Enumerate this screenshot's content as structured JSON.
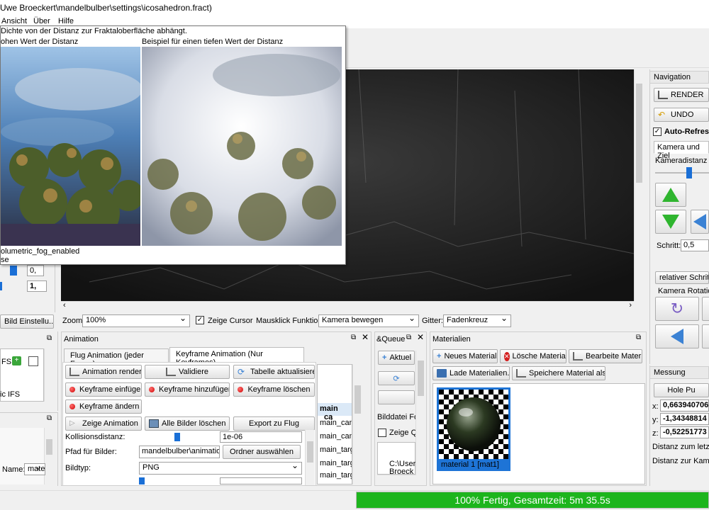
{
  "window": {
    "title": "Uwe Broeckert\\mandelbulber\\settings\\icosahedron.fract)"
  },
  "menu": [
    "Ansicht",
    "Über",
    "Hilfe"
  ],
  "tooltip": {
    "line1": "Dichte von der Distanz zur Fraktaloberfläche abhängt.",
    "caption_left": "ohen Wert der Distanz",
    "caption_right": "Beispiel für einen tiefen Wert der Distanz",
    "param": "olumetric_fog_enabled",
    "param2": "se"
  },
  "left_top": {
    "value1": "0,",
    "value2": "1,",
    "bild_btn": "Bild Einstellu..."
  },
  "viewer_bar": {
    "zoom_label": "Zoom:",
    "zoom_value": "100%",
    "cursor_label": "Zeige Cursor",
    "maus_label": "Mausklick Funktion:",
    "maus_value": "Kamera bewegen",
    "gitter_label": "Gitter:",
    "gitter_value": "Fadenkreuz"
  },
  "navigation": {
    "title": "Navigation",
    "render": "RENDER",
    "undo": "UNDO",
    "auto_refresh": "Auto-Refres",
    "kamera_tab": "Kamera und Ziel",
    "kameradistanz": "Kameradistanz zu",
    "schritt_label": "Schritt:",
    "schritt_value": "0,5",
    "relativer": "relativer Schrittm",
    "kamera_rotation": "Kamera Rotation"
  },
  "left_mid": {
    "fs_label": "FS",
    "ic_label": "ic IFS"
  },
  "left_bottom": {
    "name_label": "Name:",
    "name_value": "mate"
  },
  "animation": {
    "title": "Animation",
    "tab_flug": "Flug Animation (jeder Frame)",
    "tab_keyframe": "Keyframe Animation (Nur Keyframes)",
    "btn_render": "Animation rendern",
    "btn_validiere": "Validiere",
    "btn_tabelle": "Tabelle aktualisieren",
    "btn_einfuegen": "Keyframe einfügen",
    "btn_hinzufuegen": "Keyframe hinzufügen",
    "btn_loeschen": "Keyframe löschen",
    "btn_aendern": "Keyframe ändern",
    "btn_zeige": "Zeige Animation",
    "btn_alle": "Alle Bilder löschen",
    "btn_export": "Export zu Flug",
    "kollision_label": "Kollisionsdistanz:",
    "kollision_value": "1e-06",
    "pfad_label": "Pfad für Bilder:",
    "pfad_value": "mandelbulber\\animation\\",
    "ordner_btn": "Ordner auswählen",
    "bildtyp_label": "Bildtyp:",
    "bildtyp_value": "PNG",
    "table_header": [
      "main",
      "ca"
    ],
    "table_rows": [
      "main_cam",
      "main_cam",
      "main_targ",
      "main_targ",
      "main_targ",
      "main_targ"
    ]
  },
  "queue": {
    "title": "&Queue",
    "aktuel": "Aktuel",
    "bilddatei": "Bilddatei Fo",
    "zeige": "Zeige Q",
    "path1": "C:\\User",
    "path2": "Broeck"
  },
  "materialien": {
    "title": "Materialien",
    "btn_neu": "Neues Material",
    "btn_loesche": "Lösche Material",
    "btn_bearbeite": "Bearbeite Material",
    "btn_lade": "Lade Materialien...",
    "btn_speichere": "Speichere Material als...",
    "item_label": "material 1 [mat1]"
  },
  "messung": {
    "title": "Messung",
    "hole": "Hole Pu",
    "x_label": "x:",
    "x_value": "0,663940706",
    "y_label": "y:",
    "y_value": "-1,34348814",
    "z_label": "z:",
    "z_value": "-0,52251773",
    "dist1": "Distanz zum letzte",
    "dist2": "Distanz zur Kamer"
  },
  "status": {
    "text": "100% Fertig, Gesamtzeit: 5m 35.5s",
    "progress": 1.0,
    "color": "#1db51d"
  }
}
